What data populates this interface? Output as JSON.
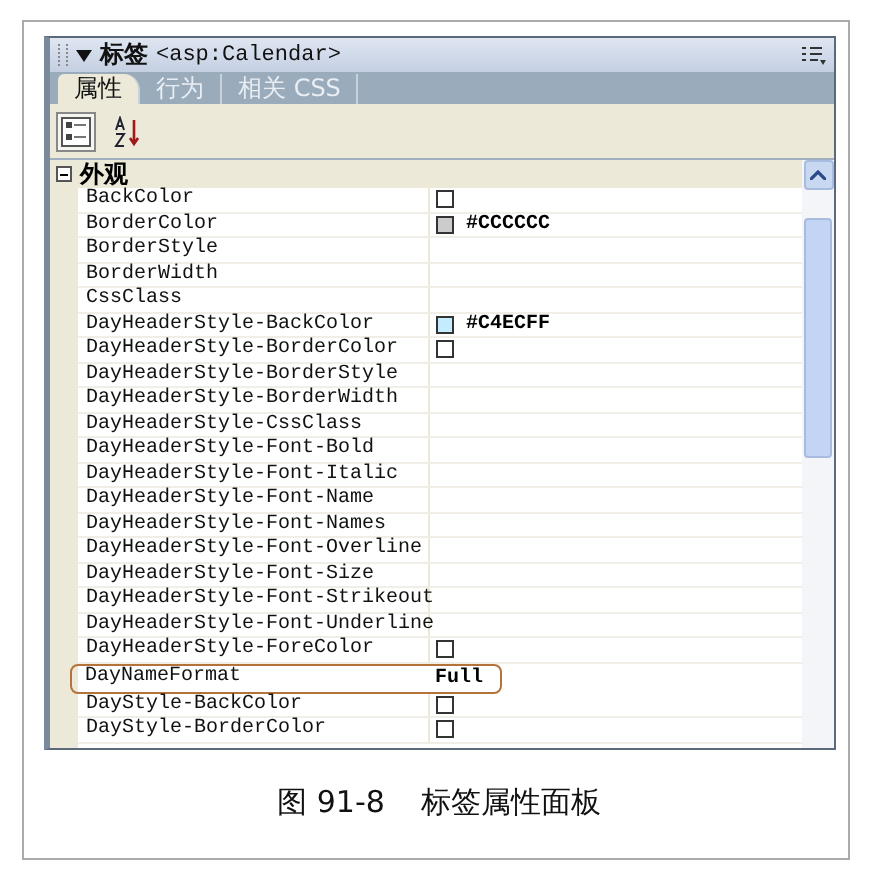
{
  "panel": {
    "title": "标签",
    "tag": "<asp:Calendar>"
  },
  "tabs": [
    {
      "label": "属性",
      "selected": true
    },
    {
      "label": "行为",
      "selected": false
    },
    {
      "label": "相关 CSS",
      "selected": false
    }
  ],
  "toolbar": [
    {
      "kind": "category",
      "selected": true
    },
    {
      "kind": "sort",
      "selected": false
    }
  ],
  "group": {
    "label": "外观",
    "expanded": true
  },
  "rows": [
    {
      "name": "BackColor",
      "kind": "color",
      "highlighted": false
    },
    {
      "name": "BorderColor",
      "kind": "color",
      "color": "#cccccc",
      "value": "#CCCCCC",
      "highlighted": false
    },
    {
      "name": "BorderStyle",
      "kind": "text",
      "highlighted": false
    },
    {
      "name": "BorderWidth",
      "kind": "text",
      "highlighted": false
    },
    {
      "name": "CssClass",
      "kind": "text",
      "highlighted": false
    },
    {
      "name": "DayHeaderStyle-BackColor",
      "kind": "color",
      "color": "#c4ecff",
      "value": "#C4ECFF",
      "highlighted": false
    },
    {
      "name": "DayHeaderStyle-BorderColor",
      "kind": "color",
      "highlighted": false
    },
    {
      "name": "DayHeaderStyle-BorderStyle",
      "kind": "text",
      "highlighted": false
    },
    {
      "name": "DayHeaderStyle-BorderWidth",
      "kind": "text",
      "highlighted": false
    },
    {
      "name": "DayHeaderStyle-CssClass",
      "kind": "text",
      "highlighted": false
    },
    {
      "name": "DayHeaderStyle-Font-Bold",
      "kind": "text",
      "highlighted": false
    },
    {
      "name": "DayHeaderStyle-Font-Italic",
      "kind": "text",
      "highlighted": false
    },
    {
      "name": "DayHeaderStyle-Font-Name",
      "kind": "text",
      "highlighted": false
    },
    {
      "name": "DayHeaderStyle-Font-Names",
      "kind": "text",
      "highlighted": false
    },
    {
      "name": "DayHeaderStyle-Font-Overline",
      "kind": "text",
      "highlighted": false
    },
    {
      "name": "DayHeaderStyle-Font-Size",
      "kind": "text",
      "highlighted": false
    },
    {
      "name": "DayHeaderStyle-Font-Strikeout",
      "kind": "text",
      "highlighted": false
    },
    {
      "name": "DayHeaderStyle-Font-Underline",
      "kind": "text",
      "highlighted": false
    },
    {
      "name": "DayHeaderStyle-ForeColor",
      "kind": "color",
      "highlighted": false
    },
    {
      "name": "DayNameFormat",
      "kind": "text",
      "value": "Full",
      "highlighted": true
    },
    {
      "name": "DayStyle-BackColor",
      "kind": "color",
      "highlighted": false
    },
    {
      "name": "DayStyle-BorderColor",
      "kind": "color",
      "highlighted": false
    }
  ],
  "caption": {
    "number": "图 91-8",
    "text": "标签属性面板"
  }
}
